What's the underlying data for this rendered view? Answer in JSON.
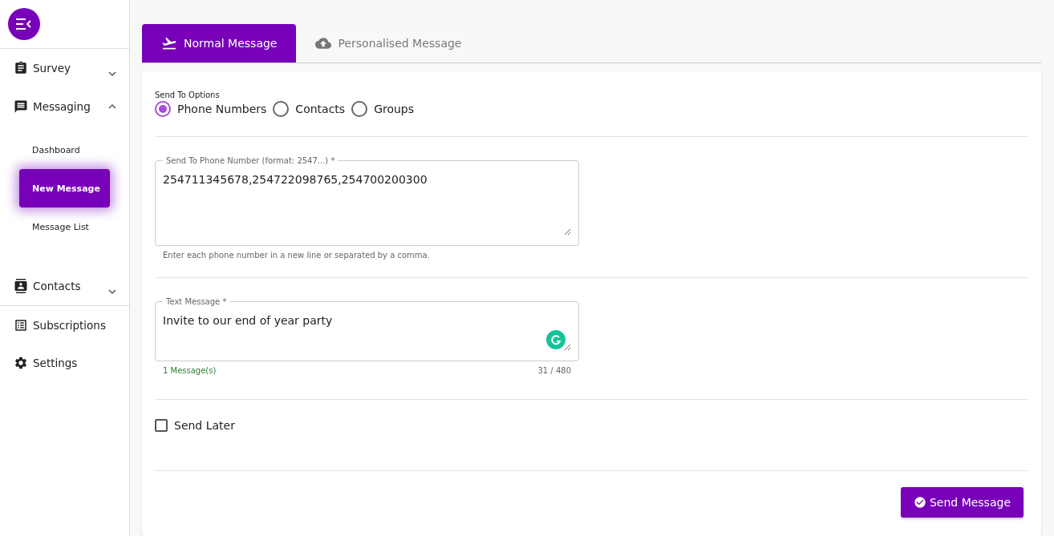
{
  "sidebar": {
    "items": [
      {
        "kind": "group",
        "label": "Survey",
        "expanded": false
      },
      {
        "kind": "group",
        "label": "Messaging",
        "expanded": true,
        "children": [
          {
            "label": "Dashboard",
            "selected": false
          },
          {
            "label": "New Message",
            "selected": true
          },
          {
            "label": "Message List",
            "selected": false
          }
        ]
      },
      {
        "kind": "group",
        "label": "Contacts",
        "expanded": false
      },
      {
        "kind": "link",
        "label": "Subscriptions"
      },
      {
        "kind": "link",
        "label": "Settings"
      }
    ]
  },
  "tabs": [
    {
      "label": "Normal Message",
      "selected": true
    },
    {
      "label": "Personalised Message",
      "selected": false
    }
  ],
  "send_to": {
    "label": "Send To Options",
    "options": [
      {
        "label": "Phone Numbers",
        "selected": true
      },
      {
        "label": "Contacts",
        "selected": false
      },
      {
        "label": "Groups",
        "selected": false
      }
    ]
  },
  "phone_field": {
    "label": "Send To Phone Number (format: 2547...) *",
    "value": "254711345678,254722098765,254700200300",
    "helper": "Enter each phone number in a new line or separated by a comma."
  },
  "message_field": {
    "label": "Text Message *",
    "value": "Invite to our end of year party",
    "count": "1 Message(s)",
    "chars": "31 / 480"
  },
  "send_later": {
    "label": "Send Later",
    "checked": false
  },
  "submit": "Send Message"
}
